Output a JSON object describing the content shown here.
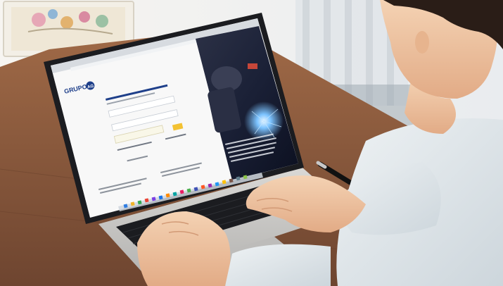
{
  "screen": {
    "brand": "GRUPO",
    "brand_badge": "AG"
  },
  "colors": {
    "wall": "#f4f1ec",
    "desk": "#8a5a3c",
    "desk_dark": "#6e4530",
    "laptop_body": "#c9c8c6",
    "bezel": "#1b1c20",
    "brand_blue": "#1e3f8a",
    "sparks": "#6fb6ff",
    "shirt": "#dfe6ea",
    "skin": "#f0c8a6",
    "hair": "#2a1d17"
  }
}
